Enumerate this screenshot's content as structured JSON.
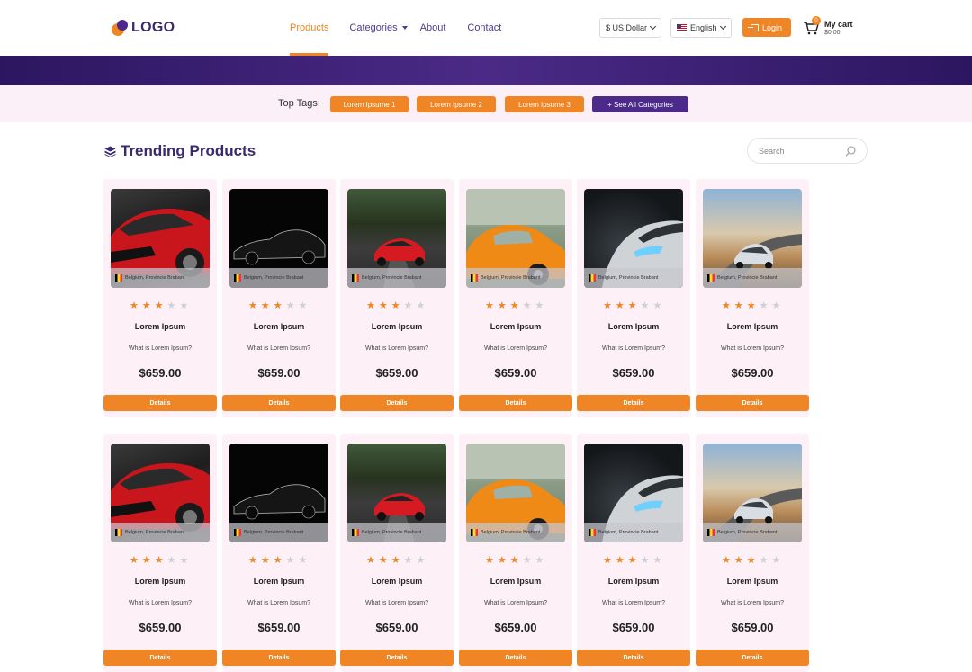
{
  "header": {
    "logo_text": "LOGO",
    "nav": [
      {
        "label": "Products",
        "active": true
      },
      {
        "label": "Categories"
      },
      {
        "label": "About"
      },
      {
        "label": "Contact"
      }
    ],
    "currency": "$ US Dollar",
    "language": "English",
    "login_label": "Login",
    "cart": {
      "title": "My cart",
      "total": "$0.00",
      "count": "0"
    }
  },
  "tags": {
    "label": "Top Tags:",
    "items": [
      "Lorem Ipsume 1",
      "Lorem Ipsume 2",
      "Lorem Ipsume 3"
    ],
    "see_all": "+ See All Categories"
  },
  "section": {
    "title": "Trending Products",
    "search_placeholder": "Search"
  },
  "products": [
    {
      "location": "Belgium, Provincie Brabant",
      "rating": 3,
      "name": "Lorem Ipsum",
      "desc": "What is Lorem Ipsum?",
      "price": "$659.00",
      "button": "Details",
      "image": "red-hatchback"
    },
    {
      "location": "Belgium, Provincie Brabant",
      "rating": 3,
      "name": "Lorem Ipsum",
      "desc": "What is Lorem Ipsum?",
      "price": "$659.00",
      "button": "Details",
      "image": "black-sedan"
    },
    {
      "location": "Belgium, Provincie Brabant",
      "rating": 3,
      "name": "Lorem Ipsum",
      "desc": "What is Lorem Ipsum?",
      "price": "$659.00",
      "button": "Details",
      "image": "red-coupe-road"
    },
    {
      "location": "Belgium, Provincie Brabant",
      "rating": 3,
      "name": "Lorem Ipsum",
      "desc": "What is Lorem Ipsum?",
      "price": "$659.00",
      "button": "Details",
      "image": "orange-beetle"
    },
    {
      "location": "Belgium, Provincie Brabant",
      "rating": 3,
      "name": "Lorem Ipsum",
      "desc": "What is Lorem Ipsum?",
      "price": "$659.00",
      "button": "Details",
      "image": "silver-car-headlight"
    },
    {
      "location": "Belgium, Provincie Brabant",
      "rating": 3,
      "name": "Lorem Ipsum",
      "desc": "What is Lorem Ipsum?",
      "price": "$659.00",
      "button": "Details",
      "image": "silver-car-road"
    }
  ],
  "colors": {
    "accent": "#ef8524",
    "brand": "#4b2a8a",
    "tag_bar": "#fbeff8",
    "card_bg": "#fdf0f7"
  }
}
